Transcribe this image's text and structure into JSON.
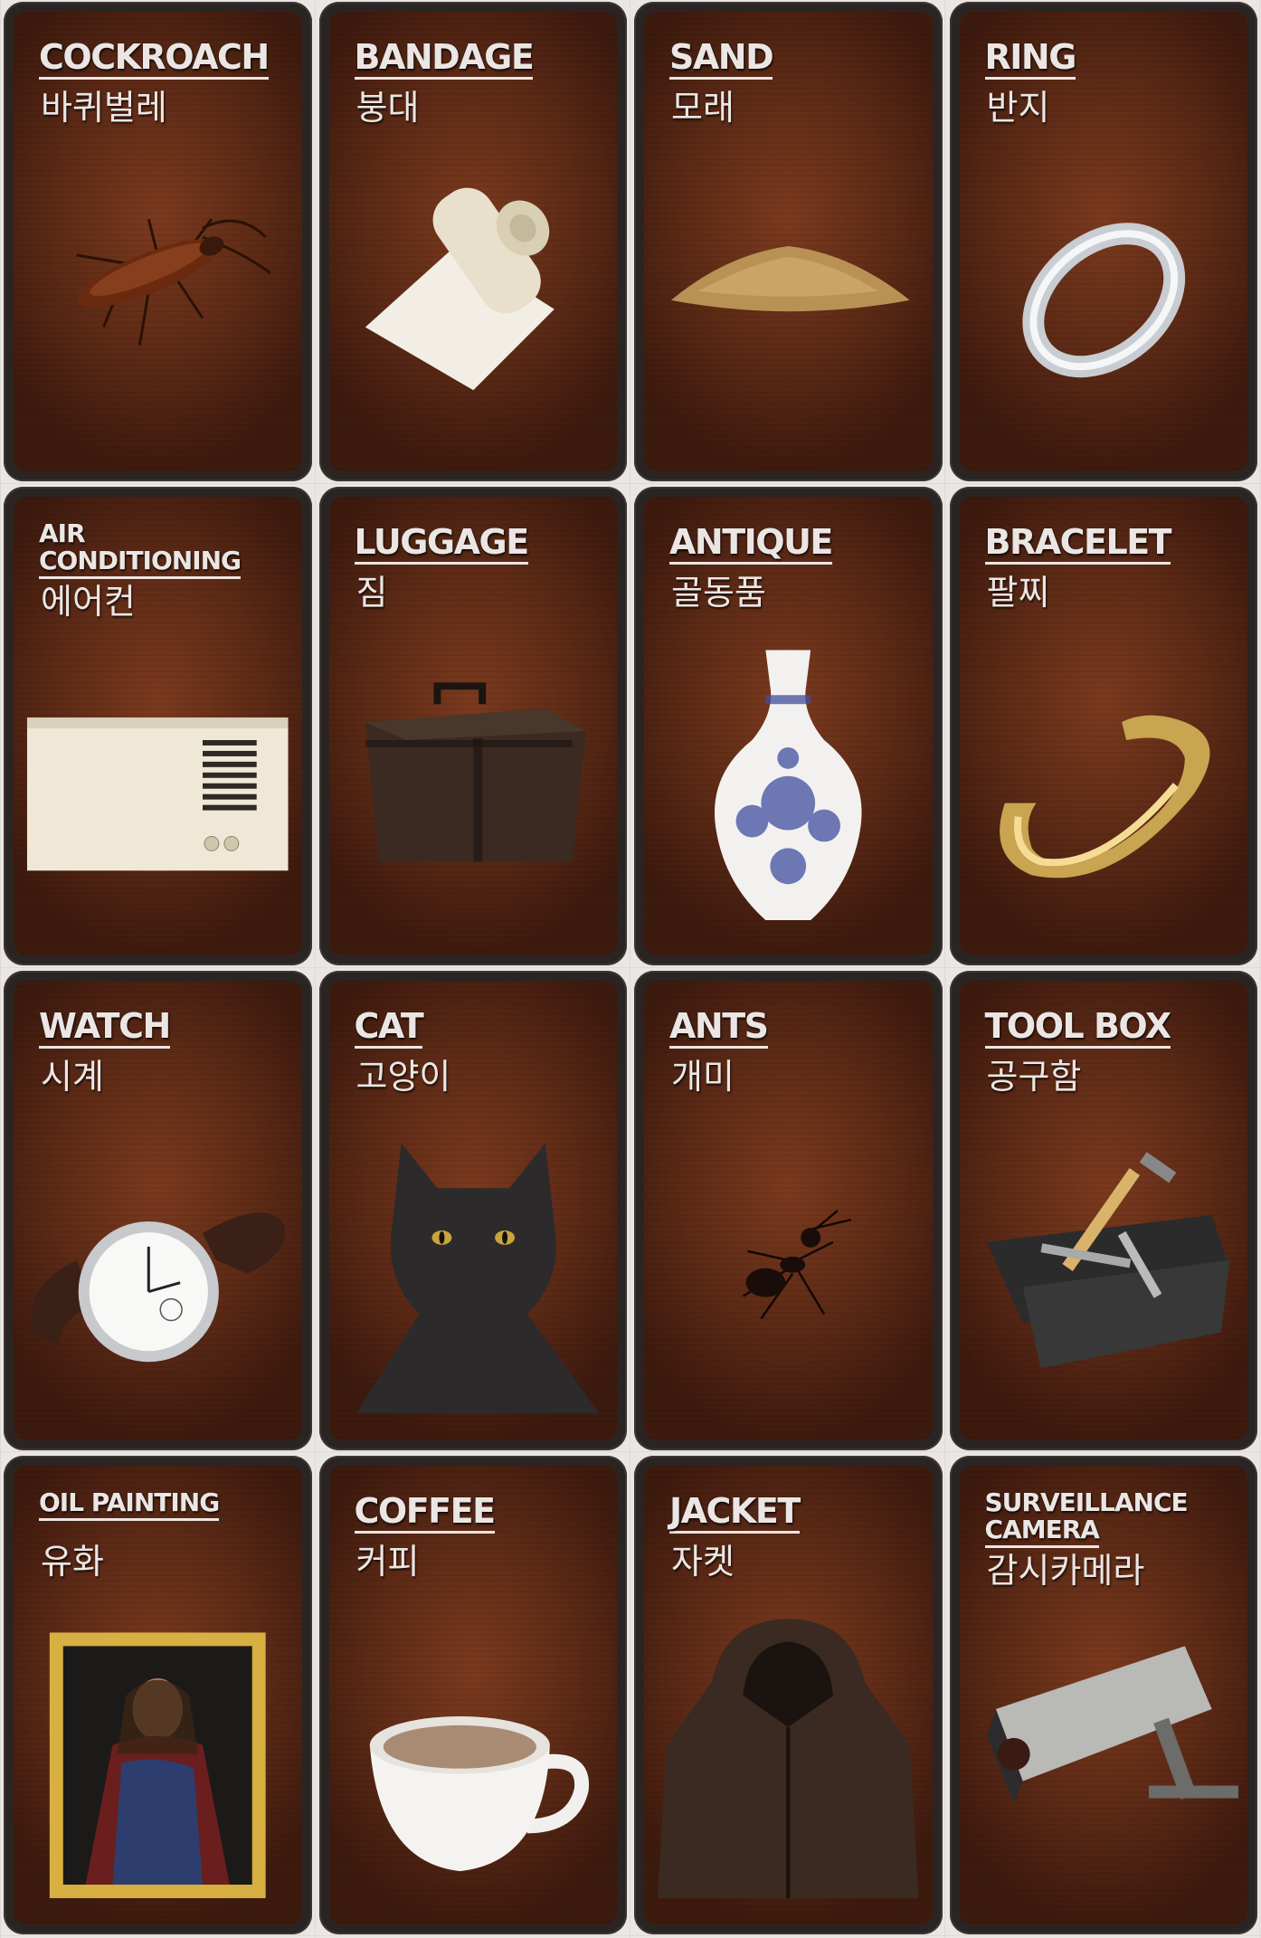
{
  "cards": [
    {
      "title": "COCKROACH",
      "korean": "바퀴벌레",
      "icon": "cockroach-icon"
    },
    {
      "title": "BANDAGE",
      "korean": "붕대",
      "icon": "bandage-icon"
    },
    {
      "title": "SAND",
      "korean": "모래",
      "icon": "sand-icon"
    },
    {
      "title": "RING",
      "korean": "반지",
      "icon": "ring-icon"
    },
    {
      "title_line1": "AIR",
      "title_line2": "CONDITIONING",
      "korean": "에어컨",
      "icon": "air-conditioner-icon"
    },
    {
      "title": "LUGGAGE",
      "korean": "짐",
      "icon": "luggage-icon"
    },
    {
      "title": "ANTIQUE",
      "korean": "골동품",
      "icon": "vase-icon"
    },
    {
      "title": "BRACELET",
      "korean": "팔찌",
      "icon": "bracelet-icon"
    },
    {
      "title": "WATCH",
      "korean": "시계",
      "icon": "watch-icon"
    },
    {
      "title": "CAT",
      "korean": "고양이",
      "icon": "cat-icon"
    },
    {
      "title": "ANTS",
      "korean": "개미",
      "icon": "ant-icon"
    },
    {
      "title": "TOOL BOX",
      "korean": "공구함",
      "icon": "toolbox-icon"
    },
    {
      "title": "OIL PAINTING",
      "korean": "유화",
      "icon": "painting-icon"
    },
    {
      "title": "COFFEE",
      "korean": "커피",
      "icon": "coffee-cup-icon"
    },
    {
      "title": "JACKET",
      "korean": "자켓",
      "icon": "jacket-icon"
    },
    {
      "title_line1": "SURVEILLANCE",
      "title_line2": "CAMERA",
      "korean": "감시카메라",
      "icon": "security-camera-icon"
    }
  ],
  "colors": {
    "card_border": "#2a2523",
    "card_face": "#6b3119",
    "text": "#ebe6e3"
  }
}
